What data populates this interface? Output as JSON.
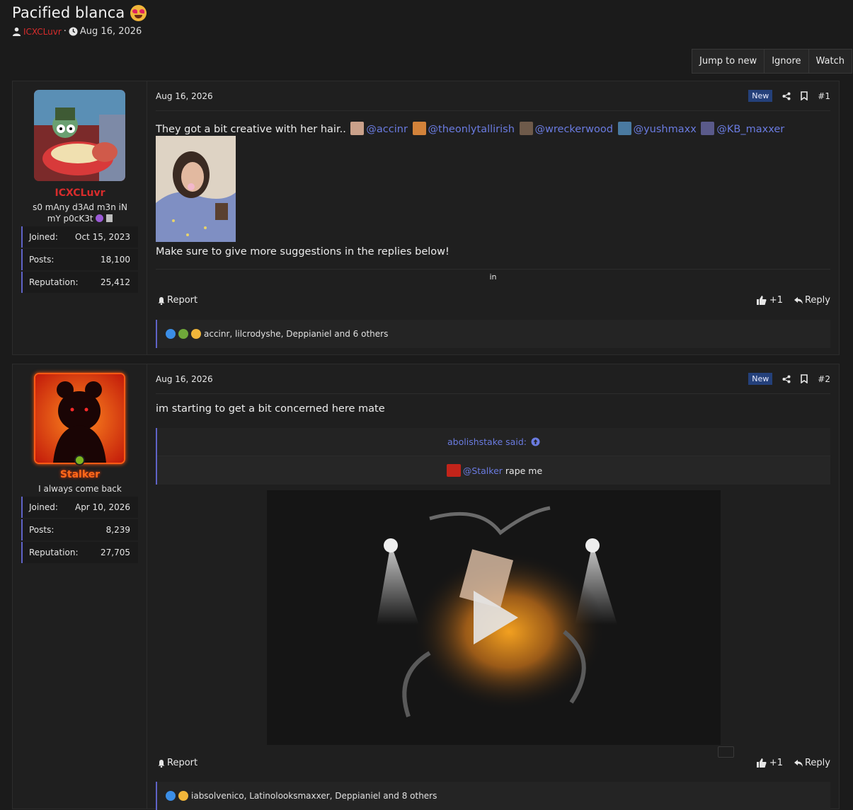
{
  "thread": {
    "title": "Pacified blanca",
    "author": "ICXCLuvr",
    "date": "Aug 16, 2026",
    "actions": [
      "Jump to new",
      "Ignore",
      "Watch"
    ]
  },
  "posts": [
    {
      "date": "Aug 16, 2026",
      "badge": "New",
      "number": "#1",
      "user": {
        "name": "ICXCLuvr",
        "title": "s0 mAny d3Ad m3n iN mY p0cK3t",
        "stats": [
          {
            "label": "Joined:",
            "value": "Oct 15, 2023"
          },
          {
            "label": "Posts:",
            "value": "18,100"
          },
          {
            "label": "Reputation:",
            "value": "25,412"
          }
        ]
      },
      "text_intro": "They got a bit creative with her hair..",
      "mentions": [
        "@accinr",
        "@theonlytallirish",
        "@wreckerwood",
        "@yushmaxx",
        "@KB_maxxer"
      ],
      "text_outro": "Make sure to give more suggestions in the replies below!",
      "signature": "in",
      "report": "Report",
      "like_count": "+1",
      "reply": "Reply",
      "reactions_text": "accinr, lilcrodyshe, Deppianiel and 6 others"
    },
    {
      "date": "Aug 16, 2026",
      "badge": "New",
      "number": "#2",
      "user": {
        "name": "Stalker",
        "title": "I always come back",
        "stats": [
          {
            "label": "Joined:",
            "value": "Apr 10, 2026"
          },
          {
            "label": "Posts:",
            "value": "8,239"
          },
          {
            "label": "Reputation:",
            "value": "27,705"
          }
        ]
      },
      "text": "im starting to get a bit concerned here mate",
      "quote": {
        "source": "abolishstake said:",
        "mention": "@Stalker",
        "text": "rape me"
      },
      "report": "Report",
      "like_count": "+1",
      "reply": "Reply",
      "reactions_text": "iabsolvenico, Latinolooksmaxxer, Deppianiel and 8 others"
    }
  ],
  "colors": {
    "accent": "#5f63c7",
    "link": "#6a7be0",
    "username_1": "#d82c2c",
    "username_2": "#ff6a1a",
    "badge": "#24407a"
  }
}
